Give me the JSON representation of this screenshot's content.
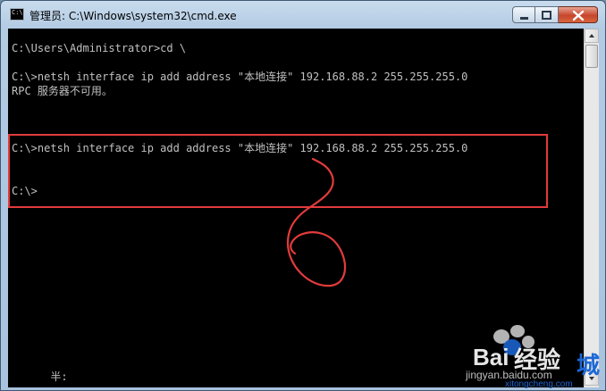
{
  "window": {
    "title": "管理员: C:\\Windows\\system32\\cmd.exe",
    "app_icon_label": "C:\\",
    "controls": {
      "minimize": "minimize",
      "maximize": "maximize",
      "close": "close"
    }
  },
  "console": {
    "lines": [
      "C:\\Users\\Administrator>cd \\",
      "",
      "C:\\>netsh interface ip add address \"本地连接\" 192.168.88.2 255.255.255.0",
      "RPC 服务器不可用。",
      "",
      "",
      "",
      "C:\\>netsh interface ip add address \"本地连接\" 192.168.88.2 255.255.255.0",
      "",
      "",
      "C:\\>",
      "",
      "",
      "",
      "",
      "",
      "",
      "",
      "",
      "",
      "",
      "",
      "",
      "      半:"
    ]
  },
  "annotation": {
    "highlight_color": "#e23b3b",
    "scribble_digit": "6"
  },
  "watermark": {
    "brand": "Bai",
    "jingyan": "经验",
    "cheng": "城",
    "url": "jingyan.baidu.com",
    "url2": "xitongcheng.com"
  },
  "colors": {
    "console_bg": "#000000",
    "console_fg": "#c0c0c0",
    "accent": "#e23b3b",
    "brand": "#1c67d6"
  }
}
